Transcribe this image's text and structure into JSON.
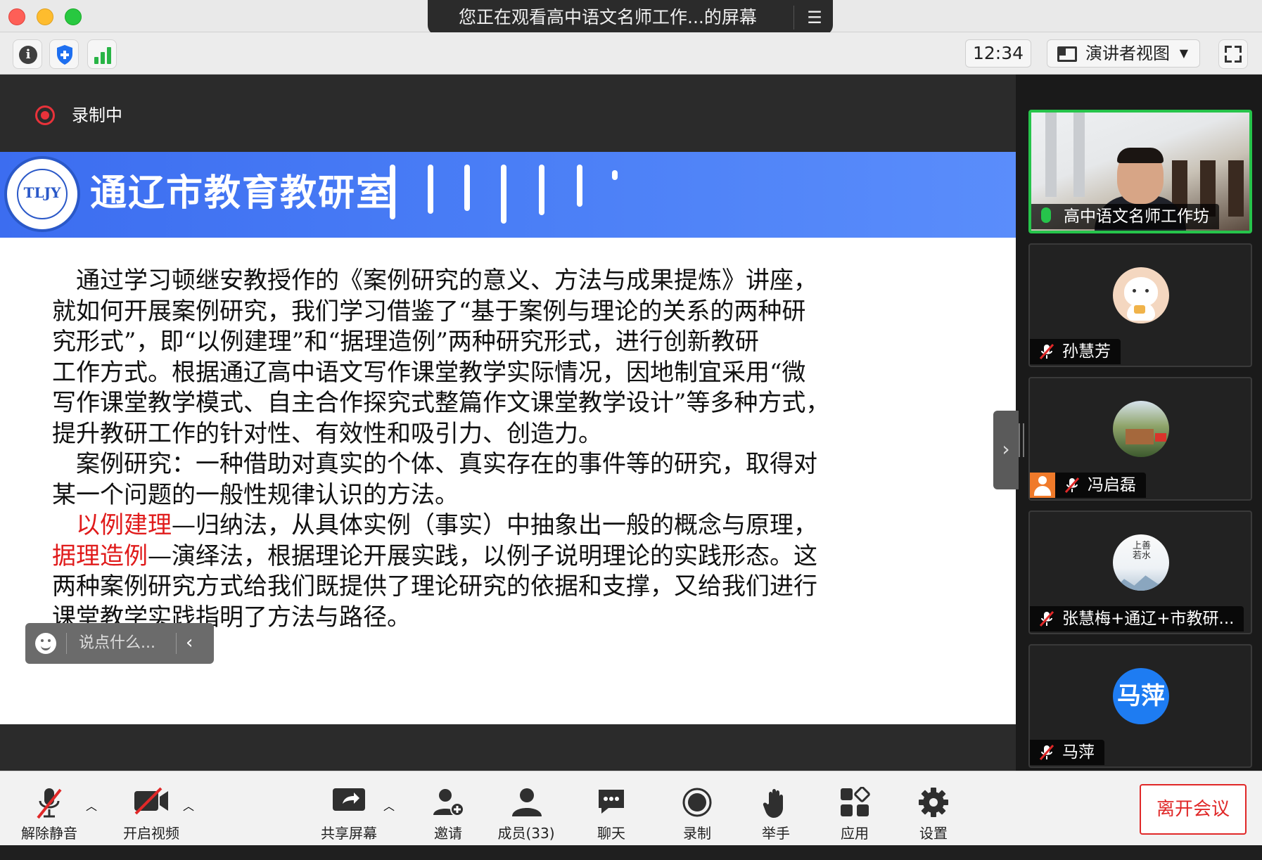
{
  "window": {
    "share_banner": "您正在观看高中语文名师工作...的屏幕"
  },
  "toolbar": {
    "timer": "12:34",
    "view_label": "演讲者视图"
  },
  "recording": {
    "label": "录制中"
  },
  "slide": {
    "org_name": "通辽市教育教研室",
    "logo_text": "TLJY",
    "lines": [
      "　通过学习顿继安教授作的《案例研究的意义、方法与成果提炼》讲座，",
      "就如何开展案例研究，我们学习借鉴了“基于案例与理论的关系的两种研",
      "究形式”，即“以例建理”和“据理造例”两种研究形式，进行创新教研",
      "工作方式。根据通辽高中语文写作课堂教学实际情况，因地制宜采用“微",
      "写作课堂教学模式、自主合作探究式整篇作文课堂教学设计”等多种方式，",
      "提升教研工作的针对性、有效性和吸引力、创造力。",
      "　案例研究：一种借助对真实的个体、真实存在的事件等的研究，取得对",
      "某一个问题的一般性规律认识的方法。"
    ],
    "para3_term1": "以例建理",
    "para3_rest1": "—归纳法，从具体实例（事实）中抽象出一般的概念与原理，",
    "para3_term2": "据理造例",
    "para3_rest2": "—演绎法，根据理论开展实践，以例子说明理论的实践形态。这",
    "para3_line3": "两种案例研究方式给我们既提供了理论研究的依据和支撑，又给我们进行",
    "para3_line4": "课堂教学实践指明了方法与路径。"
  },
  "chat": {
    "placeholder": "说点什么..."
  },
  "participants": [
    {
      "name": "高中语文名师工作坊",
      "mic": "on",
      "video": true
    },
    {
      "name": "孙慧芳",
      "mic": "muted",
      "avatar": "cat-cartoon"
    },
    {
      "name": "冯启磊",
      "mic": "muted",
      "avatar": "photo",
      "host_icon": true
    },
    {
      "name": "张慧梅+通辽+市教研...",
      "mic": "muted",
      "avatar": "ink-painting",
      "avatar_text": "上善若水"
    },
    {
      "name": "马萍",
      "mic": "muted",
      "avatar_text": "马萍",
      "avatar_color": "#1e7cf2"
    }
  ],
  "bottom": {
    "unmute": "解除静音",
    "start_video": "开启视频",
    "share_screen": "共享屏幕",
    "invite": "邀请",
    "members": "成员(33)",
    "chat": "聊天",
    "record": "录制",
    "raise_hand": "举手",
    "apps": "应用",
    "settings": "设置",
    "leave": "离开会议"
  },
  "colors": {
    "accent_red": "#e02828",
    "active_speaker": "#26c44b",
    "banner_blue": "#4a7ef6"
  }
}
